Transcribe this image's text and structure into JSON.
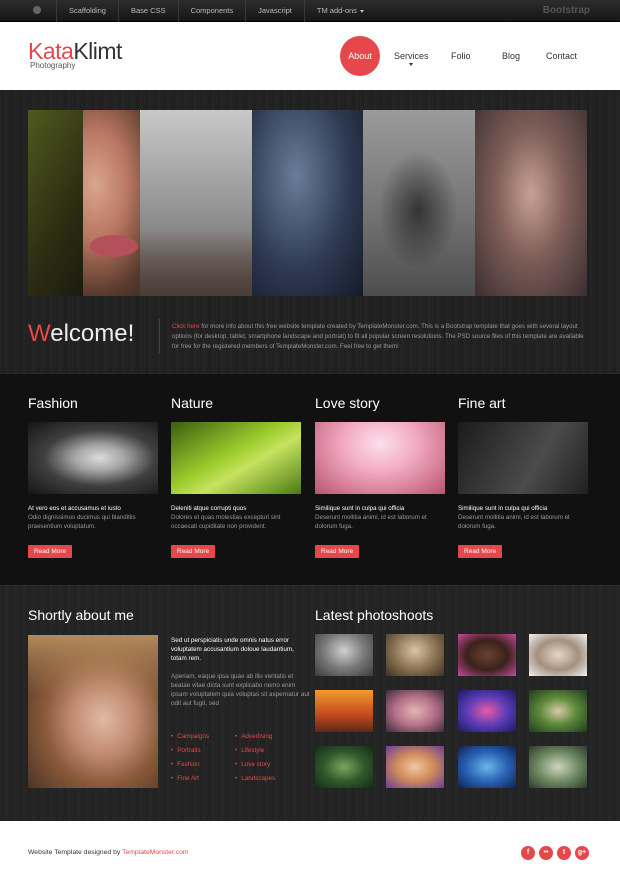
{
  "topbar": {
    "items": [
      "Scaffolding",
      "Base CSS",
      "Components",
      "Javascript",
      "TM add-ons"
    ],
    "brand": "Bootstrap"
  },
  "logo": {
    "part1": "Kata",
    "part2": "Klimt",
    "subtitle": "Photography"
  },
  "nav": [
    "About",
    "Services",
    "Folio",
    "Blog",
    "Contact"
  ],
  "welcome": {
    "first_letter": "W",
    "rest": "elcome!",
    "link": "Click here",
    "text": " for more info about this free website template created by TemplateMonster.com. This is a Bootstrap template that goes with several layout options (for desktop, tablet, smartphone landscape and portrait) to fit all popular screen resolutions. The PSD source files of this template are available for free for the registered members of TemplateMonster.com. Feel free to get them!"
  },
  "categories": [
    {
      "title": "Fashion",
      "headline": "At vero eos et accusamus et iusto",
      "text": "Odio dignissimos ducimus qui blanditiis praesentium voluptatum.",
      "button": "Read More"
    },
    {
      "title": "Nature",
      "headline": "Deleniti atque corrupti quos",
      "text": "Dolores et quas molestias excepturi sint occaecati cupiditate non provident.",
      "button": "Read More"
    },
    {
      "title": "Love story",
      "headline": "Similique sunt in culpa qui officia",
      "text": "Deserunt mollitia animi, id est laborum et dolorum fuga.",
      "button": "Read More"
    },
    {
      "title": "Fine art",
      "headline": "Similique sunt in culpa qui officia",
      "text": "Deserunt mollitia animi, id est laborum et dolorum fuga.",
      "button": "Read More"
    }
  ],
  "about": {
    "title": "Shortly about me",
    "lead": "Sed ut perspiciatis unde omnis natus error voluptatem accusantium doloue laudantium, totam rem.",
    "text": "Aperiam, eaque ipsa quae ab illo veritatis et beatae vitae dicta sunt explicabo nemo enim ipsam voluptatem quia voluptas sit aspernatur aut odit aut fugit, sed",
    "links_left": [
      "Campaigns",
      "Portraits",
      "Fashion",
      "Fine Art"
    ],
    "links_right": [
      "Advertising",
      "Lifestyle",
      "Love story",
      "Landscapes"
    ]
  },
  "photoshoots": {
    "title": "Latest photoshoots"
  },
  "footer": {
    "credit": "Website Template designed by ",
    "link": "TemplateMonster.com",
    "socials": [
      "f",
      "••",
      "t",
      "g+"
    ]
  }
}
